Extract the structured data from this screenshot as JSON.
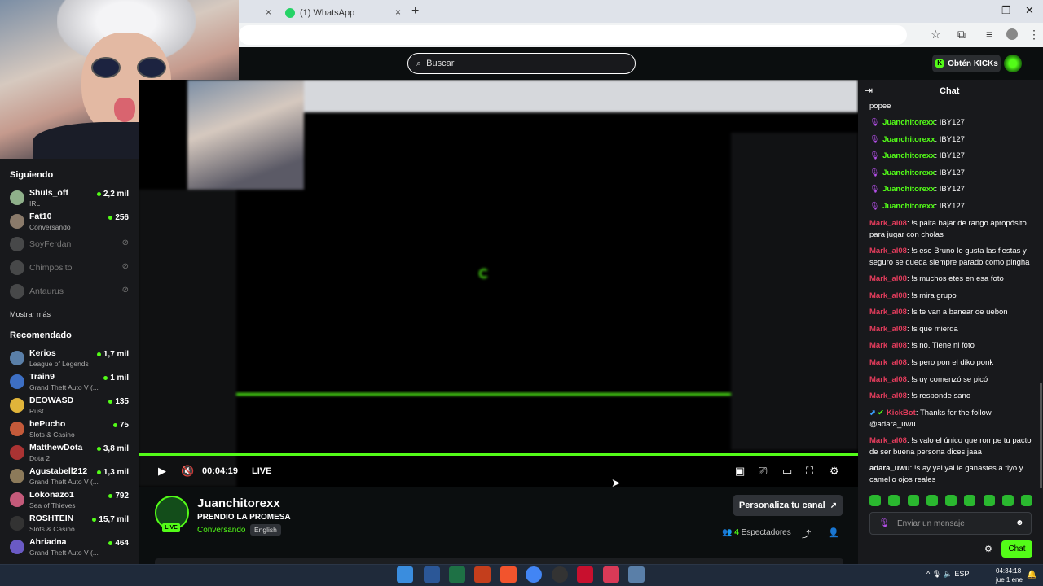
{
  "browser": {
    "tabs": [
      {
        "label": "",
        "close": "×"
      },
      {
        "label": "(1) WhatsApp",
        "close": "×"
      }
    ],
    "new_tab": "+",
    "window_controls": [
      "—",
      "❐",
      "✕"
    ]
  },
  "header": {
    "search_placeholder": "Buscar",
    "kicks_button": "Obtén KICKs"
  },
  "sidebar": {
    "following_heading": "Siguiendo",
    "following": [
      {
        "name": "Shuls_off",
        "category": "IRL",
        "viewers": "2,2 mil",
        "online": true,
        "color": "#8fb08a"
      },
      {
        "name": "Fat10",
        "category": "Conversando",
        "viewers": "256",
        "online": true,
        "color": "#8a7a6a"
      },
      {
        "name": "SoyFerdan",
        "category": "",
        "viewers": "",
        "online": false,
        "color": "#777"
      },
      {
        "name": "Chimposito",
        "category": "",
        "viewers": "",
        "online": false,
        "color": "#777"
      },
      {
        "name": "Antaurus",
        "category": "",
        "viewers": "",
        "online": false,
        "color": "#777"
      }
    ],
    "show_more": "Mostrar más",
    "recommended_heading": "Recomendado",
    "recommended": [
      {
        "name": "Kerios",
        "category": "League of Legends",
        "viewers": "1,7 mil",
        "color": "#5a7fa8"
      },
      {
        "name": "Train9",
        "category": "Grand Theft Auto V (...",
        "viewers": "1 mil",
        "color": "#3d6fc4"
      },
      {
        "name": "DEOWASD",
        "category": "Rust",
        "viewers": "135",
        "color": "#e0b43a"
      },
      {
        "name": "bePucho",
        "category": "Slots & Casino",
        "viewers": "75",
        "color": "#c45a3a"
      },
      {
        "name": "MatthewDota",
        "category": "Dota 2",
        "viewers": "3,8 mil",
        "color": "#a33"
      },
      {
        "name": "Agustabell212",
        "category": "Grand Theft Auto V (...",
        "viewers": "1,3 mil",
        "color": "#8c7a5a"
      },
      {
        "name": "Lokonazo1",
        "category": "Sea of Thieves",
        "viewers": "792",
        "color": "#c45a7a"
      },
      {
        "name": "ROSHTEIN",
        "category": "Slots & Casino",
        "viewers": "15,7 mil",
        "color": "#333"
      },
      {
        "name": "Ahriadna",
        "category": "Grand Theft Auto V (...",
        "viewers": "464",
        "color": "#6a5ac4"
      }
    ]
  },
  "player": {
    "time": "00:04:19",
    "live": "LIVE"
  },
  "stream": {
    "channel": "Juanchitorexx",
    "live_badge": "LIVE",
    "title": "PRENDIO LA PROMESA",
    "category": "Conversando",
    "language": "English",
    "customize": "Personaliza tu canal",
    "viewers_count": "4",
    "viewers_label": "Espectadores"
  },
  "chat": {
    "title": "Chat",
    "messages": [
      {
        "user": "",
        "text": "popee",
        "cls": ""
      },
      {
        "user": "Juanchitorexx",
        "text": ": IBY127",
        "cls": "u-juan",
        "mic": true
      },
      {
        "user": "Juanchitorexx",
        "text": ": IBY127",
        "cls": "u-juan",
        "mic": true
      },
      {
        "user": "Juanchitorexx",
        "text": ": IBY127",
        "cls": "u-juan",
        "mic": true
      },
      {
        "user": "Juanchitorexx",
        "text": ": IBY127",
        "cls": "u-juan",
        "mic": true
      },
      {
        "user": "Juanchitorexx",
        "text": ": IBY127",
        "cls": "u-juan",
        "mic": true
      },
      {
        "user": "Juanchitorexx",
        "text": ": IBY127",
        "cls": "u-juan",
        "mic": true
      },
      {
        "user": "Mark_al08",
        "text": ": !s palta bajar de rango apropósito para jugar con cholas",
        "cls": "u-mark"
      },
      {
        "user": "Mark_al08",
        "text": ": !s ese Bruno le gusta las fiestas y seguro se queda siempre parado como pingha",
        "cls": "u-mark"
      },
      {
        "user": "Mark_al08",
        "text": ": !s muchos etes en esa foto",
        "cls": "u-mark"
      },
      {
        "user": "Mark_al08",
        "text": ": !s mira grupo",
        "cls": "u-mark"
      },
      {
        "user": "Mark_al08",
        "text": ": !s te van a banear oe uebon",
        "cls": "u-mark"
      },
      {
        "user": "Mark_al08",
        "text": ": !s que mierda",
        "cls": "u-mark"
      },
      {
        "user": "Mark_al08",
        "text": ": !s no. Tiene ni foto",
        "cls": "u-mark"
      },
      {
        "user": "Mark_al08",
        "text": ": !s pero pon el diko ponk",
        "cls": "u-mark"
      },
      {
        "user": "Mark_al08",
        "text": ": !s uy comenzó se picó",
        "cls": "u-mark"
      },
      {
        "user": "Mark_al08",
        "text": ": !s responde sano",
        "cls": "u-mark"
      },
      {
        "user": "KickBot",
        "text": ": Thanks for the follow @adara_uwu",
        "cls": "u-bot",
        "bot": true
      },
      {
        "user": "Mark_al08",
        "text": ": !s valo el único que rompe tu pacto de ser buena persona dices jaaa",
        "cls": "u-mark"
      },
      {
        "user": "adara_uwu",
        "text": ": !s ay yai yai le ganastes a tiyo y camello ojos reales",
        "cls": "u-adara"
      }
    ],
    "input_placeholder": "Enviar un mensaje",
    "send": "Chat"
  },
  "taskbar": {
    "tray": "^  🎙  🔈  ESP",
    "time": "04:34:18",
    "date": "jue 1 ene"
  },
  "colors": {
    "accent": "#53fc18",
    "mark_user": "#e43c5c",
    "bg": "#0b0e0f",
    "panel": "#18191c"
  }
}
